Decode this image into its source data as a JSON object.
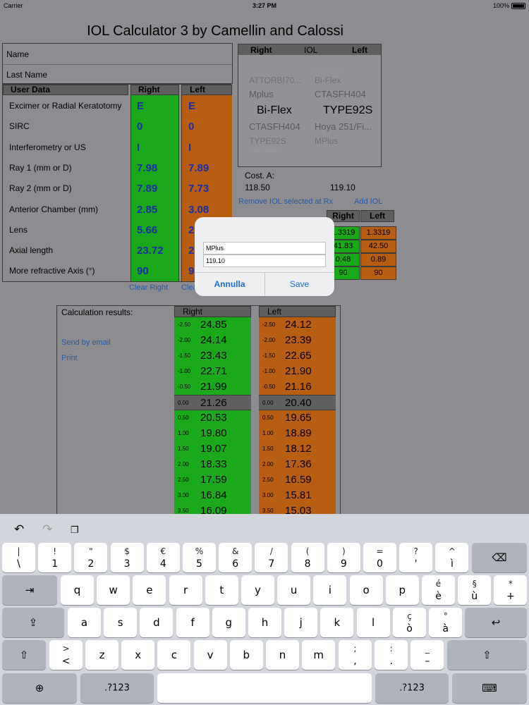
{
  "status": {
    "carrier": "Carrier",
    "time": "3:27 PM",
    "battery": "100%"
  },
  "title": "IOL Calculator 3 by Camellin and Calossi",
  "patient": {
    "name_label": "Name",
    "lastname_label": "Last Name"
  },
  "user_data": {
    "header": "User Data",
    "right_header": "Right",
    "left_header": "Left",
    "rows": [
      {
        "label": "Excimer or Radial Keratotomy",
        "right": "E",
        "left": "E"
      },
      {
        "label": "SIRC",
        "right": "0",
        "left": "0"
      },
      {
        "label": "Interferometry or US",
        "right": "I",
        "left": "I"
      },
      {
        "label": "Ray 1 (mm or D)",
        "right": "7.98",
        "left": "7.89"
      },
      {
        "label": "Ray 2 (mm or D)",
        "right": "7.89",
        "left": "7.73"
      },
      {
        "label": "Anterior Chamber (mm)",
        "right": "2.85",
        "left": "3.08"
      },
      {
        "label": "Lens",
        "right": "5.66",
        "left": "2"
      },
      {
        "label": "Axial length",
        "right": "23.72",
        "left": "2"
      },
      {
        "label": "More refractive Axis (°)",
        "right": "90",
        "left": "9"
      }
    ],
    "clear_right": "Clear Right",
    "clear_left": "Clea"
  },
  "iol_picker": {
    "header_right": "Right",
    "header_iol": "IOL",
    "header_left": "Left",
    "rows": [
      {
        "left": "",
        "right": "..................."
      },
      {
        "left": "ATTORBI70...",
        "right": "Bi-Flex"
      },
      {
        "left": "Mplus",
        "right": "CTASFH404"
      },
      {
        "left": "Bi-Flex",
        "right": "TYPE92S"
      },
      {
        "left": "CTASFH404",
        "right": "Hoya 251/Fi..."
      },
      {
        "left": "TYPE92S",
        "right": "MPlus"
      },
      {
        "left": "...................",
        "right": ""
      }
    ]
  },
  "cost": {
    "label": "Cost. A:",
    "right": "118.50",
    "left": "119.10"
  },
  "links": {
    "remove_iol": "Remove IOL selected at Rx",
    "add_iol": "Add IOL",
    "send_email": "Send by email",
    "print": "Print"
  },
  "cost_table": {
    "right_header": "Right",
    "left_header": "Left",
    "rows": [
      {
        "right": "1.3319",
        "left": "1.3319"
      },
      {
        "right": "41.83",
        "left": "42.50"
      },
      {
        "right": "0.48",
        "left": "0.89"
      },
      {
        "right": "90",
        "left": "90"
      }
    ]
  },
  "results": {
    "label": "Calculation results:",
    "right_header": "Right",
    "left_header": "Left",
    "rows": [
      {
        "power": "-2.50",
        "right": "24.85",
        "left": "24.12"
      },
      {
        "power": "-2.00",
        "right": "24.14",
        "left": "23.39"
      },
      {
        "power": "-1.50",
        "right": "23.43",
        "left": "22.65"
      },
      {
        "power": "-1.00",
        "right": "22.71",
        "left": "21.90"
      },
      {
        "power": "-0.50",
        "right": "21.99",
        "left": "21.16"
      },
      {
        "power": "0.00",
        "right": "21.26",
        "left": "20.40"
      },
      {
        "power": "0.50",
        "right": "20.53",
        "left": "19.65"
      },
      {
        "power": "1.00",
        "right": "19.80",
        "left": "18.89"
      },
      {
        "power": "1.50",
        "right": "19.07",
        "left": "18.12"
      },
      {
        "power": "2.00",
        "right": "18.33",
        "left": "17.36"
      },
      {
        "power": "2.50",
        "right": "17.59",
        "left": "16.59"
      },
      {
        "power": "3.00",
        "right": "16.84",
        "left": "15.81"
      },
      {
        "power": "3.50",
        "right": "16.09",
        "left": "15.03"
      }
    ]
  },
  "dialog": {
    "field1": "MPlus",
    "field2": "119.10",
    "cancel": "Annulla",
    "save": "Save"
  },
  "keyboard": {
    "row1": [
      {
        "top": "|",
        "bot": "\\"
      },
      {
        "top": "!",
        "bot": "1"
      },
      {
        "top": "\"",
        "bot": "2"
      },
      {
        "top": "$",
        "bot": "3"
      },
      {
        "top": "€",
        "bot": "4"
      },
      {
        "top": "%",
        "bot": "5"
      },
      {
        "top": "&",
        "bot": "6"
      },
      {
        "top": "/",
        "bot": "7"
      },
      {
        "top": "(",
        "bot": "8"
      },
      {
        "top": ")",
        "bot": "9"
      },
      {
        "top": "=",
        "bot": "0"
      },
      {
        "top": "?",
        "bot": "'"
      },
      {
        "top": "^",
        "bot": "ì"
      }
    ],
    "row2": [
      "q",
      "w",
      "e",
      "r",
      "t",
      "y",
      "u",
      "i",
      "o",
      "p"
    ],
    "row2_extra": [
      {
        "top": "é",
        "bot": "è"
      },
      {
        "top": "§",
        "bot": "ù"
      },
      {
        "top": "*",
        "bot": "+"
      }
    ],
    "row3": [
      "a",
      "s",
      "d",
      "f",
      "g",
      "h",
      "j",
      "k",
      "l"
    ],
    "row3_extra": [
      {
        "top": "ç",
        "bot": "ò"
      },
      {
        "top": "°",
        "bot": "à"
      }
    ],
    "row4_first": {
      "top": ">",
      "bot": "<"
    },
    "row4": [
      "z",
      "x",
      "c",
      "v",
      "b",
      "n",
      "m"
    ],
    "row4_extra": [
      {
        "top": ";",
        "bot": ","
      },
      {
        "top": ":",
        "bot": "."
      },
      {
        "top": "_",
        "bot": "–"
      }
    ],
    "num_label": ".?123"
  }
}
